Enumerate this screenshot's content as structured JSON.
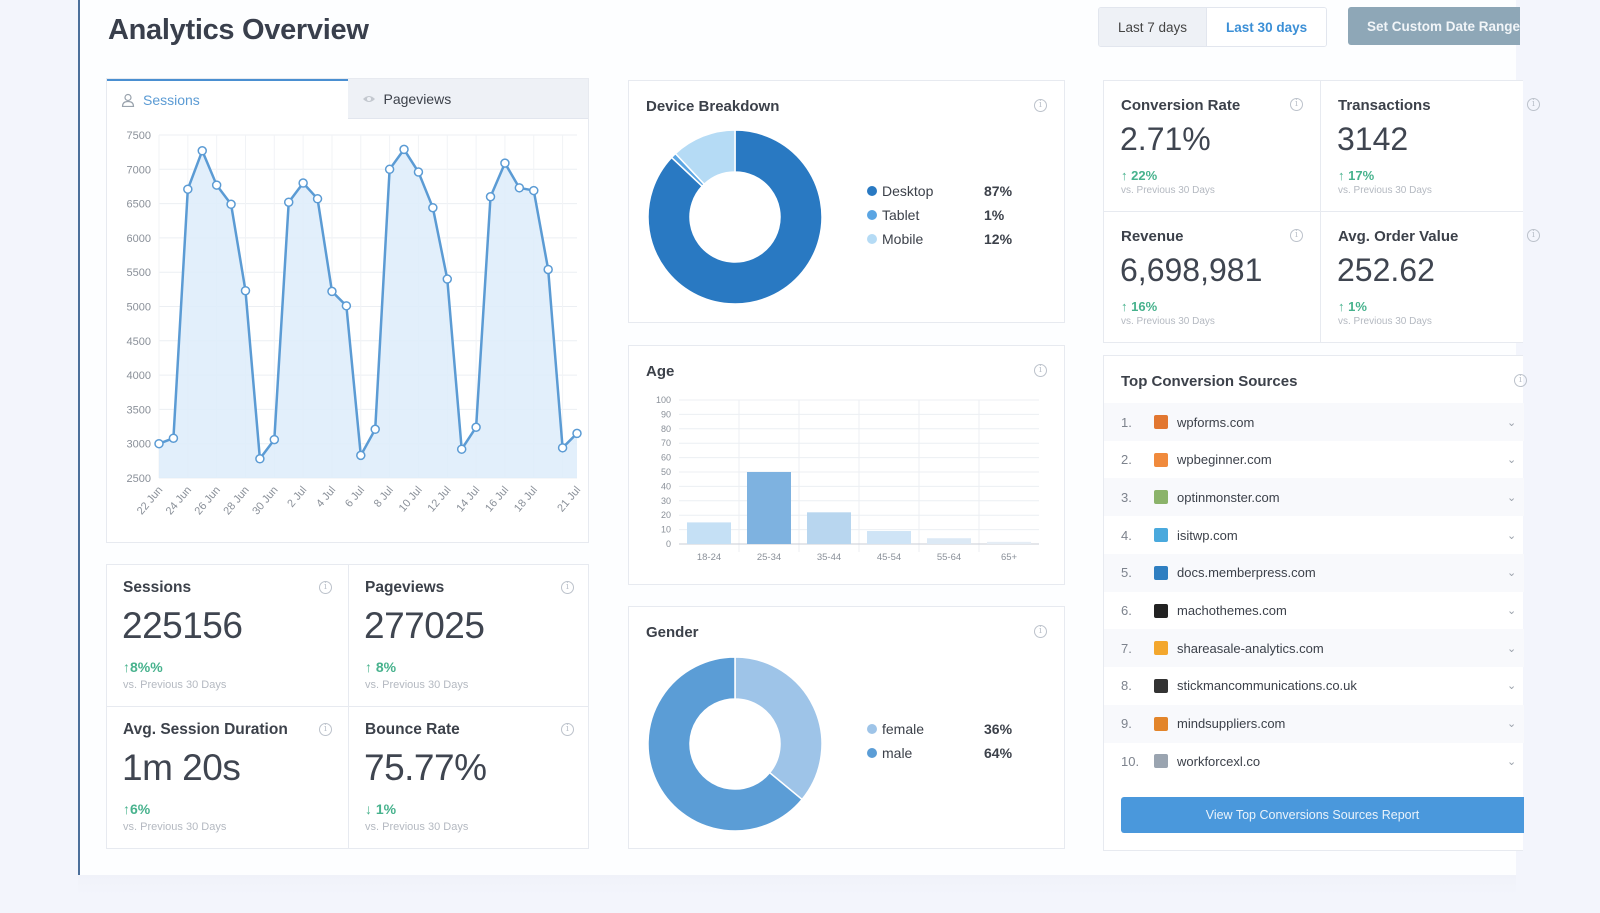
{
  "header": {
    "title": "Analytics Overview",
    "range_buttons": [
      {
        "label": "Last 7 days",
        "active": false
      },
      {
        "label": "Last 30 days",
        "active": true
      }
    ],
    "custom_range_label": "Set Custom Date Range"
  },
  "chart_tabs": [
    {
      "label": "Sessions",
      "icon": "user-icon",
      "active": true
    },
    {
      "label": "Pageviews",
      "icon": "eye-icon",
      "active": false
    }
  ],
  "chart_data": [
    {
      "type": "area",
      "title": "Sessions",
      "xlabel": "",
      "ylabel": "",
      "ylim": [
        2500,
        7500
      ],
      "y_ticks": [
        2500,
        3000,
        3500,
        4000,
        4500,
        5000,
        5500,
        6000,
        6500,
        7000,
        7500
      ],
      "x": [
        "22 Jun",
        "23 Jun",
        "24 Jun",
        "25 Jun",
        "26 Jun",
        "27 Jun",
        "28 Jun",
        "29 Jun",
        "30 Jun",
        "1 Jul",
        "2 Jul",
        "3 Jul",
        "4 Jul",
        "5 Jul",
        "6 Jul",
        "7 Jul",
        "8 Jul",
        "9 Jul",
        "10 Jul",
        "11 Jul",
        "12 Jul",
        "13 Jul",
        "14 Jul",
        "15 Jul",
        "16 Jul",
        "17 Jul",
        "18 Jul",
        "19 Jul",
        "20 Jul",
        "21 Jul"
      ],
      "x_tick_labels": [
        "22 Jun",
        "24 Jun",
        "26 Jun",
        "28 Jun",
        "30 Jun",
        "2 Jul",
        "4 Jul",
        "6 Jul",
        "8 Jul",
        "10 Jul",
        "12 Jul",
        "14 Jul",
        "16 Jul",
        "18 Jul",
        "21 Jul"
      ],
      "series": [
        {
          "name": "Sessions",
          "color": "#5b9bd4",
          "values": [
            3000,
            3080,
            6710,
            7270,
            6770,
            6490,
            5230,
            2780,
            3060,
            6520,
            6800,
            6570,
            5220,
            5010,
            2830,
            3210,
            7000,
            7290,
            6960,
            6440,
            5400,
            2920,
            3240,
            6600,
            7090,
            6730,
            6690,
            5540,
            2940,
            3150
          ]
        }
      ],
      "grid": true
    },
    {
      "type": "pie",
      "title": "Device Breakdown",
      "categories": [
        "Desktop",
        "Tablet",
        "Mobile"
      ],
      "values": [
        87,
        1,
        12
      ],
      "colors": [
        "#2979c2",
        "#5aa5e3",
        "#b5dbf5"
      ],
      "labels": [
        "87%",
        "1%",
        "12%"
      ]
    },
    {
      "type": "bar",
      "title": "Age",
      "categories": [
        "18-24",
        "25-34",
        "35-44",
        "45-54",
        "55-64",
        "65+"
      ],
      "values": [
        15,
        50,
        22,
        9,
        4,
        1.5
      ],
      "colors": [
        "#c5e0f5",
        "#7eb2e0",
        "#b8d6ef",
        "#cfe4f6",
        "#dce9f5",
        "#e5edf5"
      ],
      "ylim": [
        0,
        100
      ],
      "y_ticks": [
        0,
        10,
        20,
        30,
        40,
        50,
        60,
        70,
        80,
        90,
        100
      ],
      "grid": true
    },
    {
      "type": "pie",
      "title": "Gender",
      "categories": [
        "female",
        "male"
      ],
      "values": [
        36,
        64
      ],
      "colors": [
        "#9ec4e8",
        "#5b9dd6"
      ],
      "labels": [
        "36%",
        "64%"
      ]
    }
  ],
  "stats": [
    {
      "label": "Sessions",
      "value": "225156",
      "change": "8%%",
      "direction": "up",
      "sub": "vs. Previous 30 Days"
    },
    {
      "label": "Pageviews",
      "value": "277025",
      "change": "8%",
      "direction": "up",
      "sub": "vs. Previous 30 Days"
    },
    {
      "label": "Avg. Session Duration",
      "value": "1m 20s",
      "change": "6%",
      "direction": "up",
      "sub": "vs. Previous 30 Days"
    },
    {
      "label": "Bounce Rate",
      "value": "75.77%",
      "change": "1%",
      "direction": "down",
      "sub": "vs. Previous 30 Days"
    }
  ],
  "kpis": [
    {
      "label": "Conversion Rate",
      "value": "2.71%",
      "change": "22%",
      "direction": "up",
      "sub": "vs. Previous 30 Days"
    },
    {
      "label": "Transactions",
      "value": "3142",
      "change": "17%",
      "direction": "up",
      "sub": "vs. Previous 30 Days"
    },
    {
      "label": "Revenue",
      "value": "6,698,981",
      "change": "16%",
      "direction": "up",
      "sub": "vs. Previous 30 Days"
    },
    {
      "label": "Avg. Order Value",
      "value": "252.62",
      "change": "1%",
      "direction": "up",
      "sub": "vs. Previous 30 Days"
    }
  ],
  "sources": {
    "title": "Top Conversion Sources",
    "items": [
      {
        "num": "1.",
        "name": "wpforms.com",
        "icon": "wpforms-bear-icon",
        "color": "#e27730"
      },
      {
        "num": "2.",
        "name": "wpbeginner.com",
        "icon": "wpbeginner-icon",
        "color": "#f08a3c"
      },
      {
        "num": "3.",
        "name": "optinmonster.com",
        "icon": "optinmonster-icon",
        "color": "#8bb36a"
      },
      {
        "num": "4.",
        "name": "isitwp.com",
        "icon": "isitwp-icon",
        "color": "#4aa9dd"
      },
      {
        "num": "5.",
        "name": "docs.memberpress.com",
        "icon": "memberpress-icon",
        "color": "#2f7fc1"
      },
      {
        "num": "6.",
        "name": "machothemes.com",
        "icon": "machothemes-icon",
        "color": "#222222"
      },
      {
        "num": "7.",
        "name": "shareasale-analytics.com",
        "icon": "star-icon",
        "color": "#f3a72d"
      },
      {
        "num": "8.",
        "name": "stickmancommunications.co.uk",
        "icon": "stickman-icon",
        "color": "#333333"
      },
      {
        "num": "9.",
        "name": "mindsuppliers.com",
        "icon": "mindsuppliers-icon",
        "color": "#e3852a"
      },
      {
        "num": "10.",
        "name": "workforcexl.co",
        "icon": "globe-icon",
        "color": "#9aa4b0"
      }
    ],
    "button_label": "View Top Conversions Sources Report"
  },
  "glyphs": {
    "info": "i",
    "chevron": "⌄",
    "arrow_up": "↑",
    "arrow_down": "↓"
  }
}
